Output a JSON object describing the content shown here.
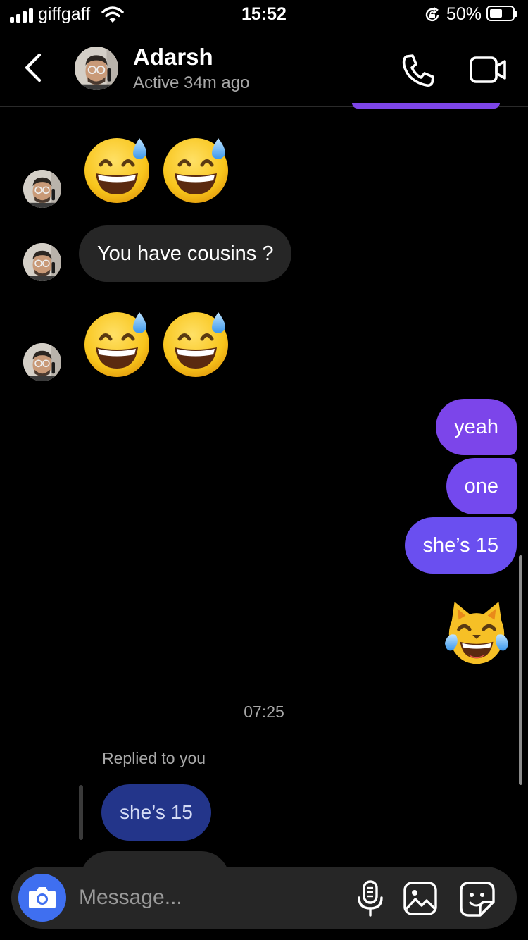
{
  "status_bar": {
    "carrier": "giffgaff",
    "time": "15:52",
    "battery": "50%"
  },
  "header": {
    "name": "Adarsh",
    "status": "Active 34m ago"
  },
  "messages": {
    "incoming_text": "You have cousins ?",
    "outgoing": [
      "yeah",
      "one",
      "she’s 15"
    ],
    "timestamp": "07:25",
    "reply_label": "Replied to you",
    "reply_quote": "she’s 15"
  },
  "icons": {
    "emoji_incoming": "grinning-face-with-sweat",
    "emoji_outgoing": "cat-with-tears-of-joy"
  },
  "composer": {
    "placeholder": "Message..."
  },
  "colors": {
    "background": "#000000",
    "incoming_bubble": "#262626",
    "outgoing_bubble": "#7a48ec",
    "camera_button": "#3f6ff0",
    "reply_bubble": "#23358a"
  }
}
